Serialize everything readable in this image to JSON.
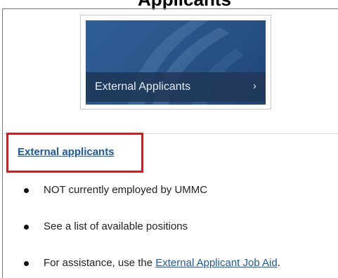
{
  "header": {
    "title_partial": "Applicants"
  },
  "banner": {
    "label": "External Applicants",
    "chevron": "›",
    "chevron_icon": "chevron-right-icon",
    "colors": {
      "background": "#2a558a",
      "overlay_bar": "#1e3454"
    }
  },
  "section": {
    "link_label": "External applicants",
    "highlight_color": "#e3161b",
    "link_color": "#1a5aa6",
    "bullets": [
      {
        "text": "NOT currently employed by UMMC"
      },
      {
        "text": "See a list of available positions"
      },
      {
        "prefix": "For assistance, use the ",
        "link": "External Applicant Job Aid",
        "suffix": "."
      }
    ]
  }
}
